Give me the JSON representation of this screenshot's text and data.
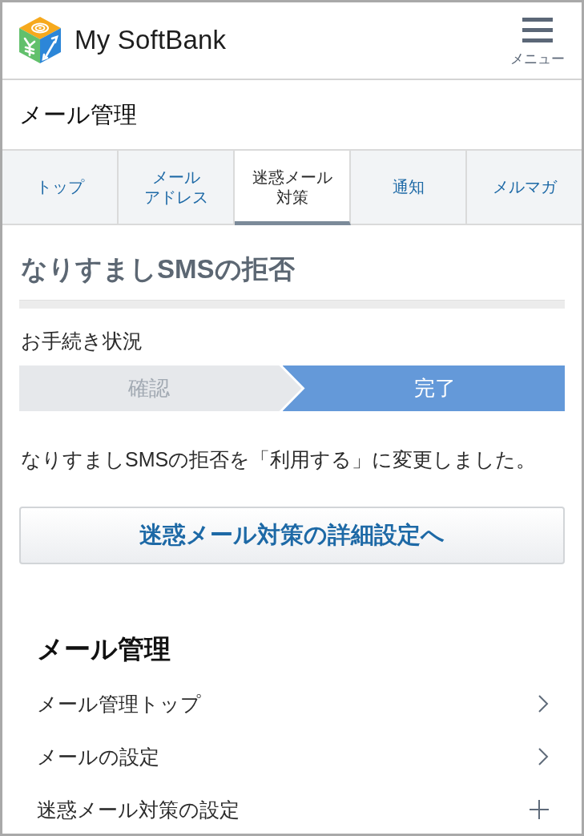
{
  "header": {
    "brand": "My SoftBank",
    "menu_label": "メニュー"
  },
  "page_title": "メール管理",
  "tabs": [
    {
      "lines": [
        "トップ"
      ],
      "selected": false
    },
    {
      "lines": [
        "メール",
        "アドレス"
      ],
      "selected": false
    },
    {
      "lines": [
        "迷惑メール",
        "対策"
      ],
      "selected": true
    },
    {
      "lines": [
        "通知"
      ],
      "selected": false
    },
    {
      "lines": [
        "メルマガ"
      ],
      "selected": false
    }
  ],
  "section": {
    "heading": "なりすましSMSの拒否",
    "progress_label": "お手続き状況",
    "steps": [
      {
        "label": "確認",
        "selected": false
      },
      {
        "label": "完了",
        "selected": true
      }
    ],
    "message": "なりすましSMSの拒否を「利用する」に変更しました。",
    "button": "迷惑メール対策の詳細設定へ"
  },
  "nav": {
    "heading": "メール管理",
    "items": [
      {
        "label": "メール管理トップ",
        "kind": "link"
      },
      {
        "label": "メールの設定",
        "kind": "link"
      },
      {
        "label": "迷惑メール対策の設定",
        "kind": "accordion",
        "expanded": false
      }
    ]
  }
}
